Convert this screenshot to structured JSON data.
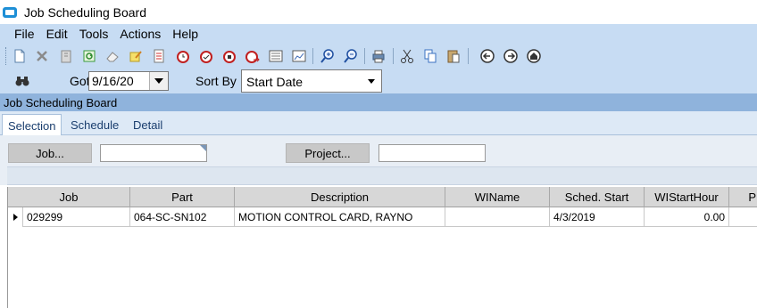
{
  "window": {
    "title": "Job Scheduling Board"
  },
  "menu": {
    "items": [
      "File",
      "Edit",
      "Tools",
      "Actions",
      "Help"
    ]
  },
  "toolbar": {
    "icons": [
      "new-icon",
      "delete-icon",
      "attach-icon",
      "refresh-icon",
      "clear-icon",
      "edit-icon",
      "checklist-icon",
      "clock-icon",
      "clock-check-icon",
      "clock-stop-icon",
      "clock-arrow-icon",
      "report-icon",
      "chart-icon",
      "zoom-in-icon",
      "zoom-out-icon",
      "print-icon",
      "cut-icon",
      "copy-icon",
      "paste-icon",
      "back-icon",
      "forward-icon",
      "home-icon"
    ]
  },
  "nav": {
    "goto_label": "Goto",
    "goto_value": "9/16/20",
    "sortby_label": "Sort By",
    "sortby_value": "Start Date"
  },
  "panel": {
    "header": "Job Scheduling Board"
  },
  "tabs": [
    "Selection",
    "Schedule",
    "Detail"
  ],
  "filters": {
    "job_button": "Job...",
    "job_value": "",
    "project_button": "Project...",
    "project_value": ""
  },
  "grid": {
    "columns": [
      "Job",
      "Part",
      "Description",
      "WIName",
      "Sched. Start",
      "WIStartHour",
      "P"
    ],
    "rows": [
      [
        "029299",
        "064-SC-SN102",
        "MOTION CONTROL CARD, RAYNO",
        "",
        "4/3/2019",
        "0.00",
        ""
      ]
    ]
  },
  "colors": {
    "toolbar_bg": "#c7dcf3",
    "panel_header": "#8fb3dc",
    "tab_text": "#1a3e6e"
  }
}
